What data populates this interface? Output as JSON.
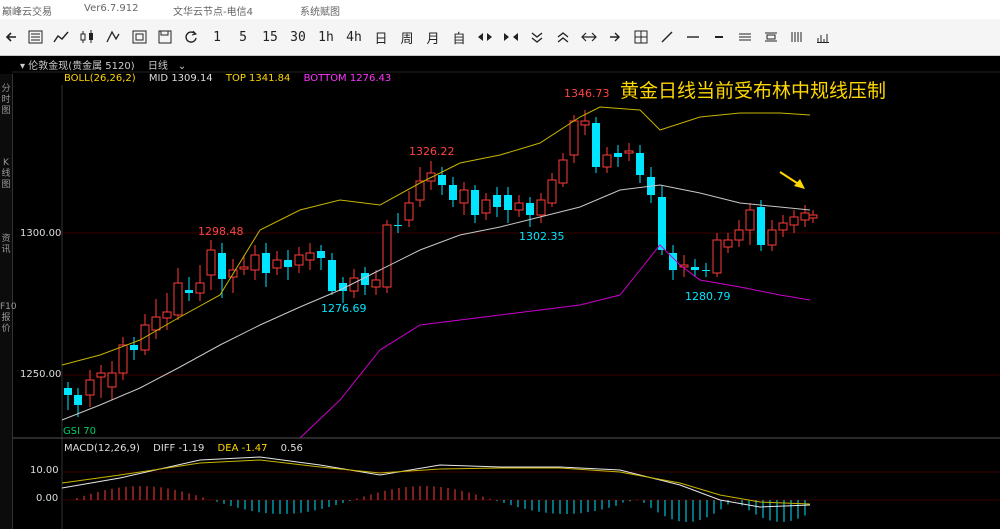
{
  "titlebar": {
    "app_name": "巅峰云交易",
    "version": "Ver6.7.912",
    "node": "文华云节点-电信4",
    "menu": "系统赋图"
  },
  "toolbar": {
    "back_icon": "arrow-left-icon",
    "periods": [
      "1",
      "5",
      "15",
      "30",
      "1h",
      "4h",
      "日",
      "周",
      "月",
      "自"
    ]
  },
  "chart": {
    "symbol": "伦敦金现(贵金属 5120)",
    "period": "日线",
    "boll_label": "BOLL(26,26,2)",
    "mid_label": "MID 1309.14",
    "top_label": "TOP 1341.84",
    "bottom_label": "BOTTOM 1276.43",
    "macd_label": "MACD(12,26,9)",
    "diff_label": "DIFF -1.19",
    "dea_label": "DEA -1.47",
    "macd_value": "0.56",
    "annotation": "黄金日线当前受布林中规线压制",
    "left_tabs": [
      "分时图",
      "K线图",
      "资讯",
      "F10报价"
    ],
    "price_labels": [
      "1300.00",
      "1250.00"
    ],
    "macd_axis": [
      "10.00",
      "0.00"
    ],
    "cut_label": "GSI 70",
    "peak_labels": [
      "1298.48",
      "1326.22",
      "1346.73",
      "1276.69",
      "1302.35",
      "1280.79"
    ],
    "colors": {
      "up": "#ff3b3b",
      "down": "#00e5ff",
      "mid": "#c8c8c8",
      "top": "#c8b400",
      "bottom": "#cc00cc",
      "annotation": "#ffd700"
    }
  }
}
